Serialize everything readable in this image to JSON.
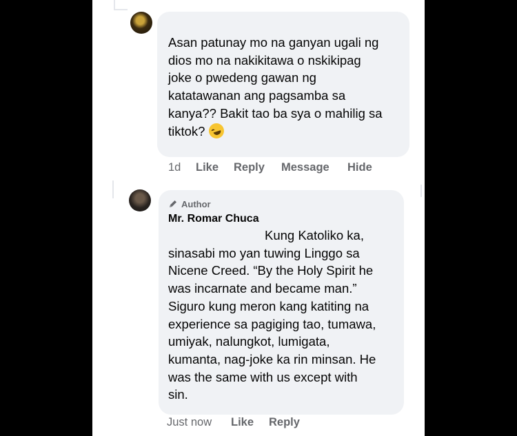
{
  "comments": [
    {
      "text": "Asan patunay mo na ganyan ugali ng\ndios mo na nakikitawa o nskikipag\njoke o pwedeng gawan ng\nkatatawanan ang pagsamba sa\nkanya?? Bakit tao ba sya o mahilig sa\ntiktok?",
      "emoji_icon": "rofl-emoji-icon",
      "actions": {
        "time": "1d",
        "like": "Like",
        "reply": "Reply",
        "message": "Message",
        "hide": "Hide"
      }
    },
    {
      "badge": "Author",
      "author": "Mr. Romar Chuca",
      "text": "Kung Katoliko ka,\nsinasabi mo yan tuwing Linggo sa\nNicene Creed. “By the Holy Spirit he\nwas incarnate and became man.”\nSiguro kung meron kang katiting na\nexperience sa pagiging tao, tumawa,\numiyak, nalungkot, lumigata,\nkumanta, nag-joke ka rin minsan. He\nwas the same with us except with\nsin.",
      "actions": {
        "time": "Just now",
        "like": "Like",
        "reply": "Reply"
      }
    }
  ],
  "colors": {
    "bubble": "#f0f2f5",
    "meta": "#65676b",
    "text": "#050505",
    "frame": "#000000"
  }
}
